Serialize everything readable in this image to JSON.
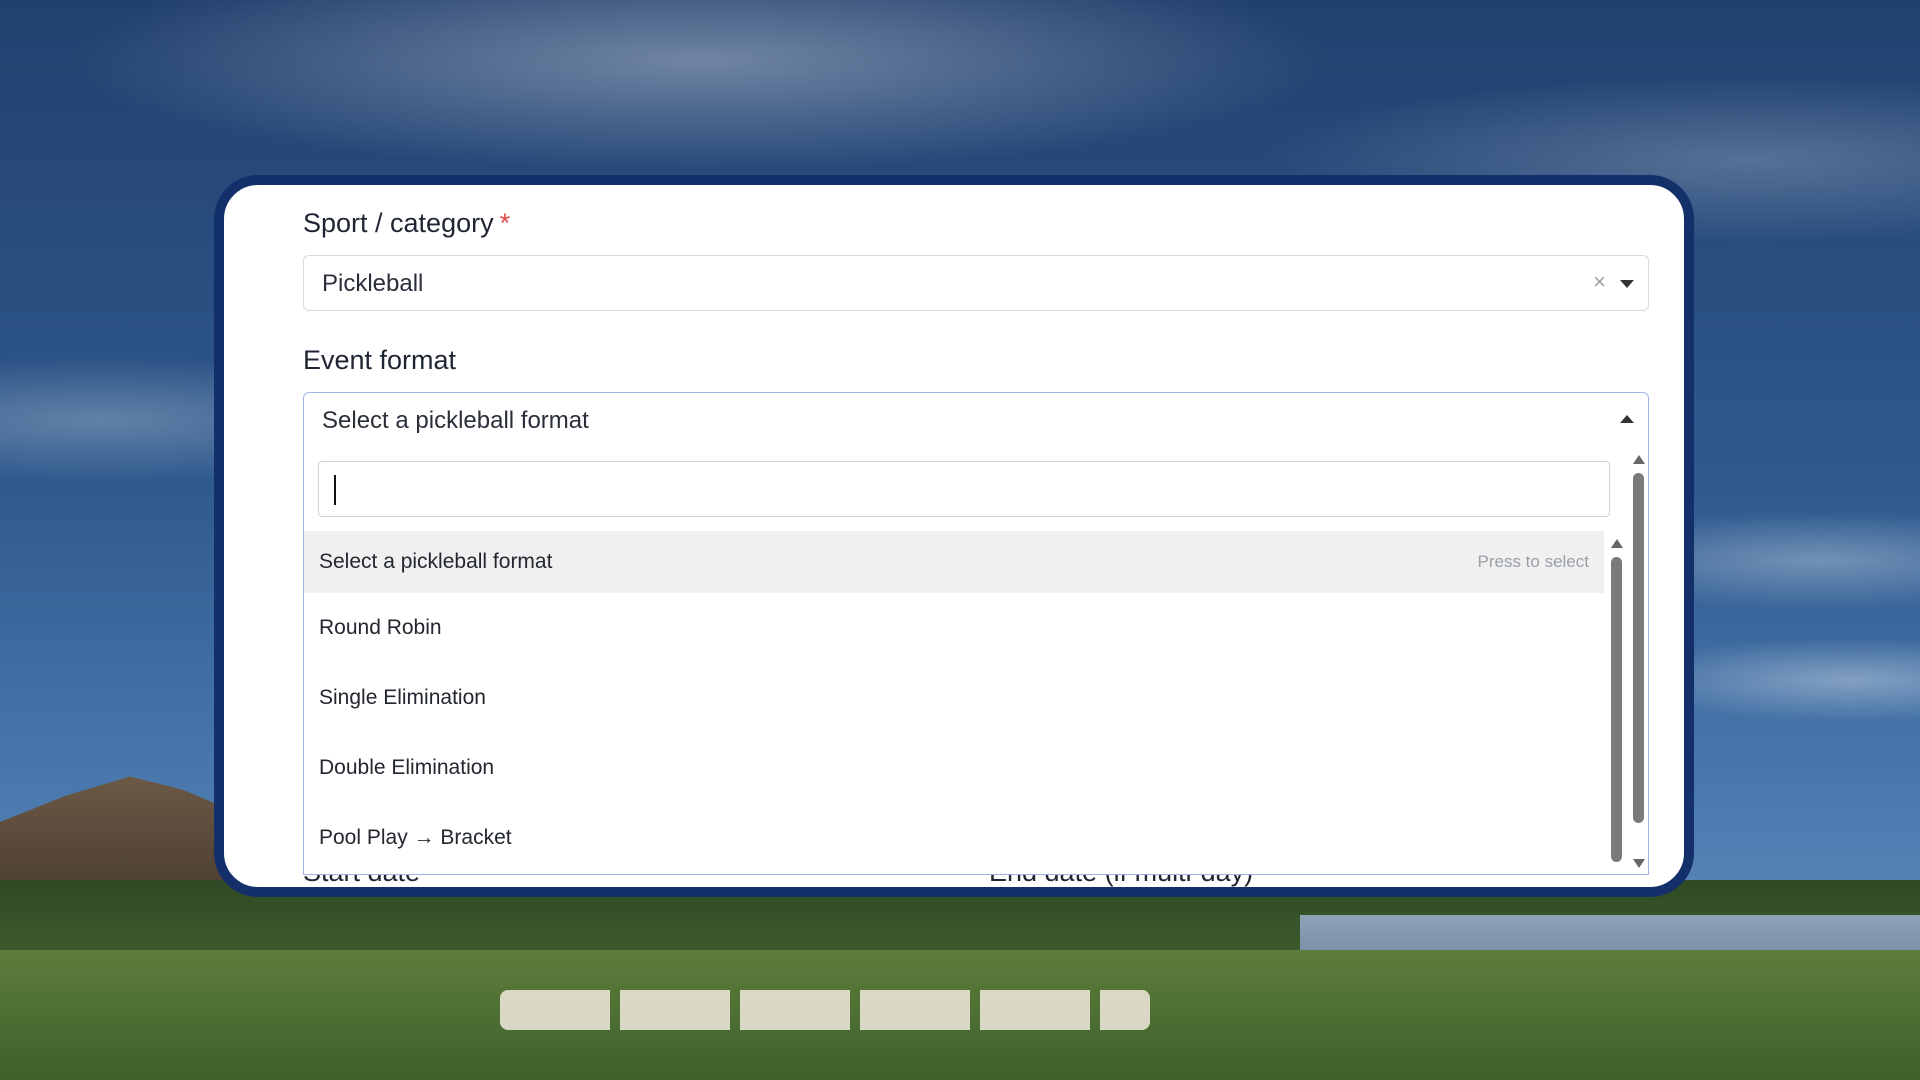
{
  "sport": {
    "label": "Sport / category",
    "required_mark": "*",
    "value": "Pickleball",
    "clear_glyph": "×"
  },
  "event_format": {
    "label": "Event format",
    "placeholder": "Select a pickleball format",
    "search_value": "",
    "options": [
      {
        "label": "Select a pickleball format",
        "hint": "Press to select",
        "highlighted": true
      },
      {
        "label": "Round Robin"
      },
      {
        "label": "Single Elimination"
      },
      {
        "label": "Double Elimination"
      },
      {
        "label": "Pool Play → Bracket"
      }
    ]
  },
  "dates": {
    "start_label": "Start date",
    "end_label": "End date (if multi-day)"
  },
  "colors": {
    "card_border": "#14306a",
    "required": "#e04848",
    "dropdown_border": "#9ab6e0",
    "highlight_row": "#f0f0f1"
  }
}
